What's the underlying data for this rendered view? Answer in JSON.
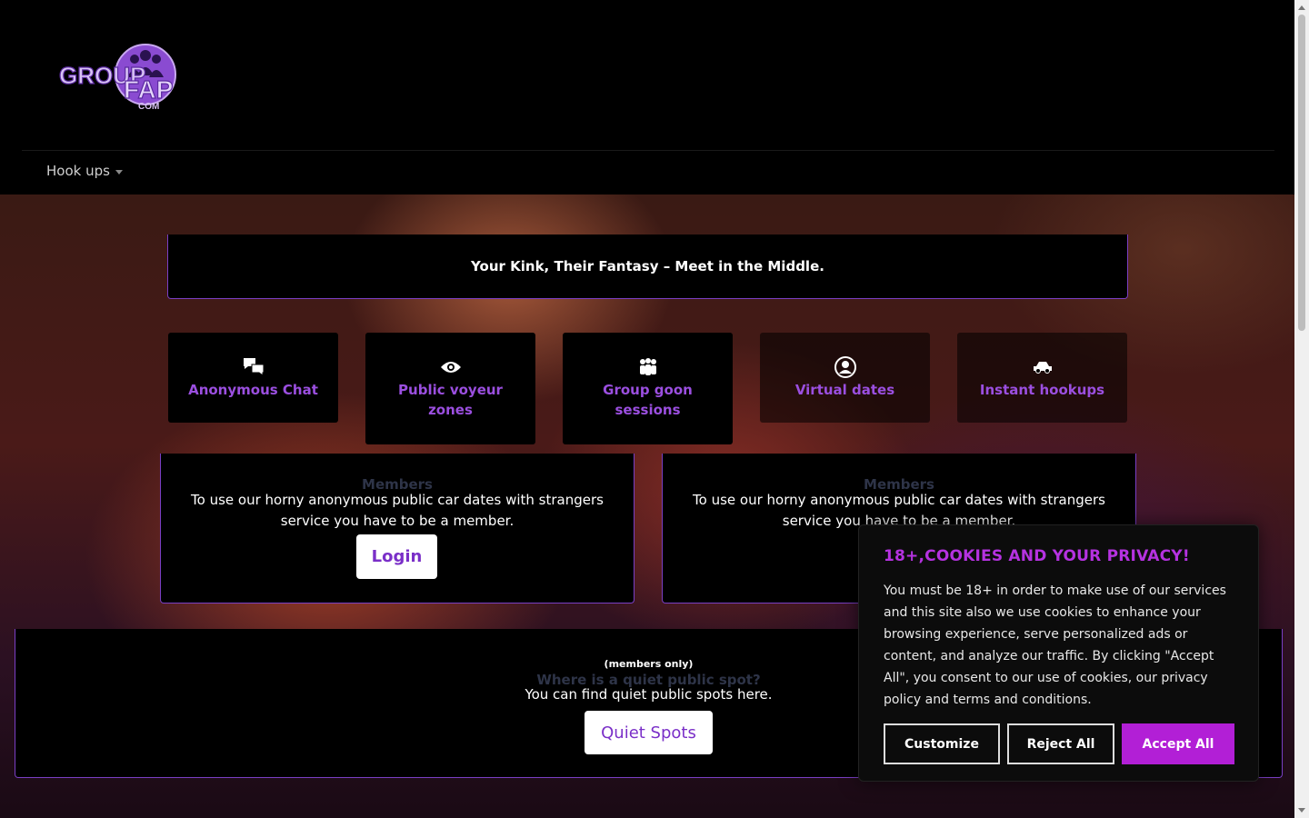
{
  "header": {
    "logo_text_top": "GROUP",
    "logo_text_main": "FAP",
    "logo_text_sub": "COM",
    "nav": [
      {
        "label": "Hook ups"
      }
    ]
  },
  "hero": {
    "tagline": "Your Kink, Their Fantasy – Meet in the Middle."
  },
  "tiles": [
    {
      "label": "Anonymous Chat",
      "icon": "chat-bubbles-icon"
    },
    {
      "label": "Public voyeur zones",
      "icon": "eye-icon"
    },
    {
      "label": "Group goon sessions",
      "icon": "group-icon"
    },
    {
      "label": "Virtual dates",
      "icon": "user-circle-icon"
    },
    {
      "label": "Instant hookups",
      "icon": "car-icon"
    }
  ],
  "members": [
    {
      "title": "Members",
      "text": "To use our horny anonymous public car dates with strangers service you have to be a member.",
      "button": "Login"
    },
    {
      "title": "Members",
      "text": "To use our horny anonymous public car dates with strangers service you have to be a member."
    }
  ],
  "quiet": {
    "members_only": "(members only)",
    "title": "Where is a quiet public spot?",
    "text": "You can find quiet public spots here.",
    "button": "Quiet Spots"
  },
  "cookie": {
    "title": "18+,COOKIES AND YOUR PRIVACY!",
    "text": "You must be 18+ in order to make use of our services and this site also we use cookies to enhance your browsing experience, serve personalized ads or content, and analyze our traffic. By clicking \"Accept All\", you consent to our use of cookies, our privacy policy and terms and conditions.",
    "customize": "Customize",
    "reject": "Reject All",
    "accept": "Accept All"
  },
  "colors": {
    "accent": "#9b4fe0",
    "accept_button": "#b21fd6",
    "border": "#7a3fc4"
  }
}
